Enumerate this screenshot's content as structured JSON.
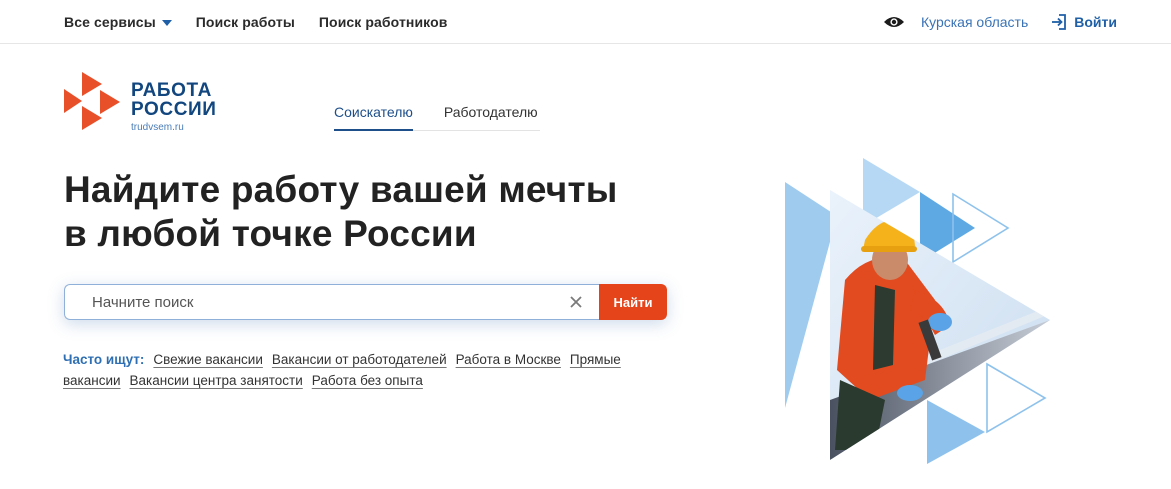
{
  "topbar": {
    "services_label": "Все сервисы",
    "nav": [
      "Поиск работы",
      "Поиск работников"
    ],
    "region": "Курская область",
    "login_label": "Войти"
  },
  "logo": {
    "line1": "РАБОТА",
    "line2": "РОССИИ",
    "domain": "trudvsem.ru"
  },
  "tabs": [
    "Соискателю",
    "Работодателю"
  ],
  "headline": {
    "line1": "Найдите работу вашей мечты",
    "line2": "в любой точке России"
  },
  "search": {
    "placeholder": "Начните поиск",
    "button_label": "Найти"
  },
  "popular": {
    "label": "Часто ищут:",
    "links": [
      "Свежие вакансии",
      "Вакансии от работодателей",
      "Работа в Москве",
      "Прямые вакансии",
      "Вакансии центра занятости",
      "Работа без опыта"
    ]
  },
  "colors": {
    "brand_blue": "#1e5fa8",
    "accent_orange": "#e5441b",
    "logo_red": "#e8502a"
  },
  "icons": [
    "chevron-down-icon",
    "eye-icon",
    "login-icon",
    "clear-icon"
  ]
}
